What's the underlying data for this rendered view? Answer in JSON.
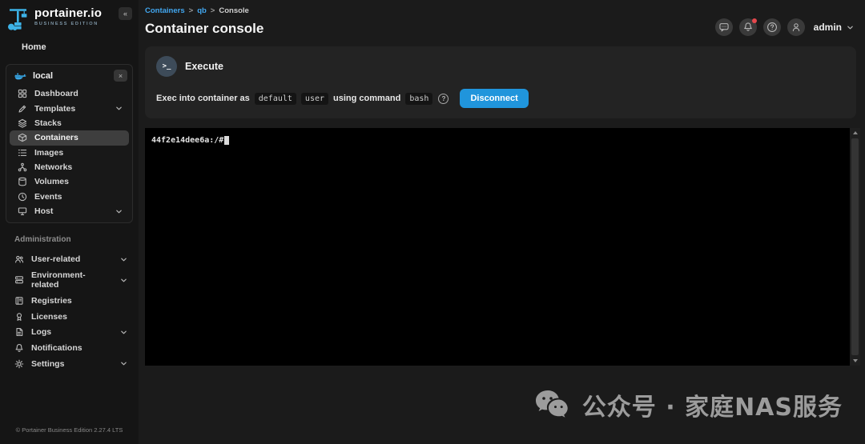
{
  "colors": {
    "accent": "#2095dc",
    "link": "#42a7f0",
    "badge": "#e5484d",
    "brand_blue": "#38a8e8"
  },
  "sidebar": {
    "logo_title": "portainer.io",
    "logo_subtitle": "BUSINESS EDITION",
    "collapse_glyph": "«",
    "home_label": "Home",
    "environment": {
      "name": "local",
      "close_glyph": "×",
      "items": [
        {
          "label": "Dashboard",
          "icon": "dashboard-icon",
          "chevron": false,
          "active": false
        },
        {
          "label": "Templates",
          "icon": "templates-icon",
          "chevron": true,
          "active": false
        },
        {
          "label": "Stacks",
          "icon": "stacks-icon",
          "chevron": false,
          "active": false
        },
        {
          "label": "Containers",
          "icon": "containers-icon",
          "chevron": false,
          "active": true
        },
        {
          "label": "Images",
          "icon": "images-icon",
          "chevron": false,
          "active": false
        },
        {
          "label": "Networks",
          "icon": "networks-icon",
          "chevron": false,
          "active": false
        },
        {
          "label": "Volumes",
          "icon": "volumes-icon",
          "chevron": false,
          "active": false
        },
        {
          "label": "Events",
          "icon": "events-icon",
          "chevron": false,
          "active": false
        },
        {
          "label": "Host",
          "icon": "host-icon",
          "chevron": true,
          "active": false
        }
      ]
    },
    "administration": {
      "heading": "Administration",
      "items": [
        {
          "label": "User-related",
          "icon": "users-icon",
          "chevron": true,
          "active": false
        },
        {
          "label": "Environment-related",
          "icon": "environments-icon",
          "chevron": true,
          "active": false
        },
        {
          "label": "Registries",
          "icon": "registries-icon",
          "chevron": false,
          "active": false
        },
        {
          "label": "Licenses",
          "icon": "licenses-icon",
          "chevron": false,
          "active": false
        },
        {
          "label": "Logs",
          "icon": "logs-icon",
          "chevron": true,
          "active": false
        },
        {
          "label": "Notifications",
          "icon": "notifications-icon",
          "chevron": false,
          "active": false
        },
        {
          "label": "Settings",
          "icon": "settings-icon",
          "chevron": true,
          "active": false
        }
      ]
    },
    "footer": "© Portainer Business Edition 2.27.4 LTS"
  },
  "header": {
    "breadcrumb": [
      {
        "label": "Containers",
        "link": true
      },
      {
        "label": "qb",
        "link": true
      },
      {
        "label": "Console",
        "link": false
      }
    ],
    "separator": ">",
    "title": "Container console",
    "actions": [
      {
        "icon": "chat-icon",
        "badge": false
      },
      {
        "icon": "bell-icon",
        "badge": true
      },
      {
        "icon": "help-icon",
        "badge": false
      },
      {
        "icon": "user-icon",
        "badge": false
      }
    ],
    "user_name": "admin"
  },
  "execute_panel": {
    "title": "Execute",
    "terminal_glyph": ">_",
    "description": [
      {
        "type": "text",
        "value": "Exec into container as"
      },
      {
        "type": "code",
        "value": "default"
      },
      {
        "type": "code",
        "value": "user"
      },
      {
        "type": "text",
        "value": "using command"
      },
      {
        "type": "code",
        "value": "bash"
      }
    ],
    "help_glyph": "?",
    "disconnect_label": "Disconnect"
  },
  "terminal": {
    "prompt": "44f2e14dee6a:/#"
  },
  "watermark": {
    "text": "公众号 · 家庭NAS服务"
  }
}
